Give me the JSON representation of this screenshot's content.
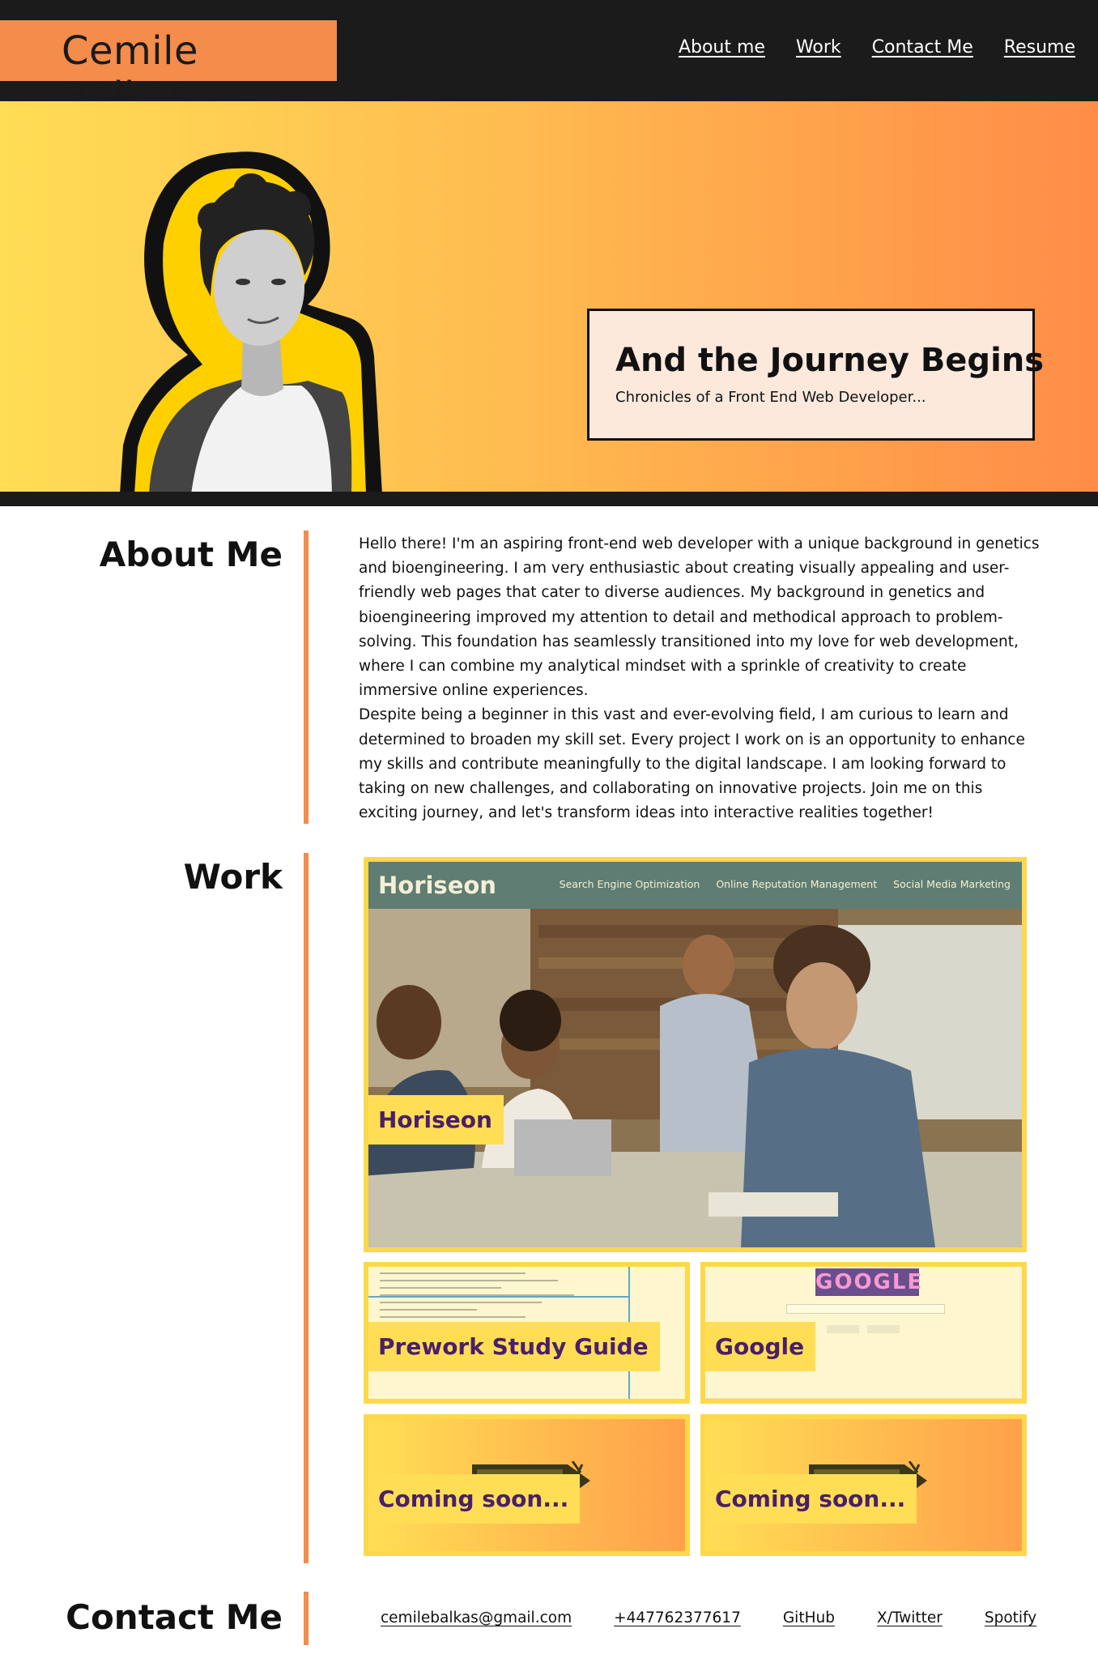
{
  "header": {
    "brand": "Cemile Balkas",
    "nav": [
      "About me",
      "Work",
      "Contact Me",
      "Resume"
    ]
  },
  "hero": {
    "title": "And the Journey Begins",
    "subtitle": "Chronicles of a Front End Web Developer..."
  },
  "about": {
    "heading": "About Me",
    "paragraphs": [
      "Hello there! I'm an aspiring front-end web developer with a unique background in genetics and bioengineering. I am very enthusiastic about creating visually appealing and user-friendly web pages that cater to diverse audiences. My background in genetics and bioengineering improved my attention to detail and methodical approach to problem-solving. This foundation has seamlessly transitioned into my love for web development, where I can combine my analytical mindset with a sprinkle of creativity to create immersive online experiences.",
      "Despite being a beginner in this vast and ever-evolving field, I am curious to learn and determined to broaden my skill set. Every project I work on is an opportunity to enhance my skills and contribute meaningfully to the digital landscape. I am looking forward to taking on new challenges, and collaborating on innovative projects. Join me on this exciting journey, and let's transform ideas into interactive realities together!"
    ]
  },
  "work": {
    "heading": "Work",
    "horiseon_preview": {
      "logo": "Horiseon",
      "links": [
        "Search Engine Optimization",
        "Online Reputation Management",
        "Social Media Marketing"
      ]
    },
    "google_preview": {
      "logo": "GOOGLE"
    },
    "projects": [
      {
        "label": "Horiseon"
      },
      {
        "label": "Prework Study Guide"
      },
      {
        "label": "Google"
      },
      {
        "label": "Coming soon..."
      },
      {
        "label": "Coming soon..."
      }
    ]
  },
  "contact": {
    "heading": "Contact Me",
    "links": [
      "cemilebalkas@gmail.com",
      "+447762377617",
      "GitHub",
      "X/Twitter",
      "Spotify"
    ]
  },
  "colors": {
    "accent": "#f48c4b",
    "dark": "#1b1b1b",
    "card_border": "#ffd84a",
    "label_text": "#4a1f6a"
  }
}
